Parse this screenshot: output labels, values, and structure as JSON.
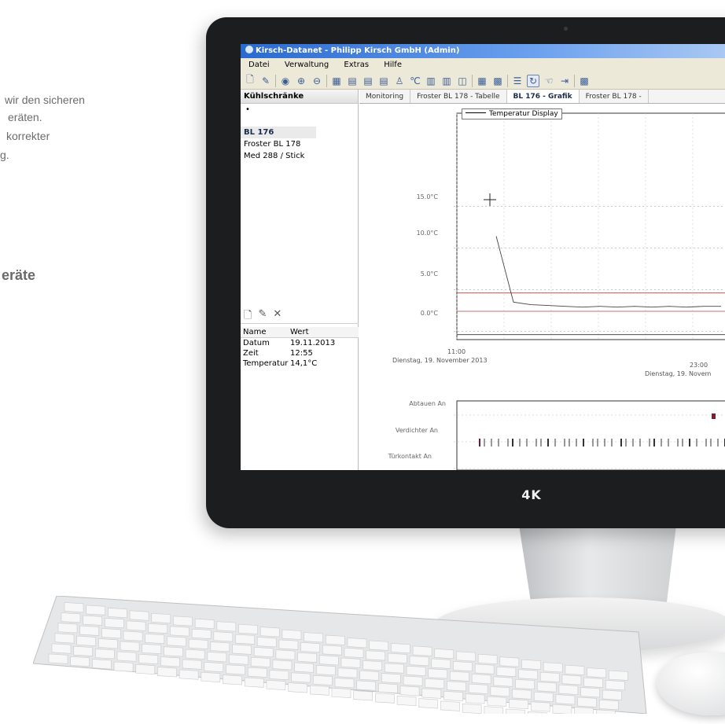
{
  "promo": {
    "line1": "wir den sicheren",
    "line2": "eräten.",
    "line3": "korrekter",
    "line4": "g.",
    "heading": "eräte"
  },
  "monitor": {
    "logo": "4K"
  },
  "app": {
    "title": "Kirsch-Datanet - Philipp Kirsch GmbH (Admin)",
    "menu": [
      "Datei",
      "Verwaltung",
      "Extras",
      "Hilfe"
    ],
    "left_pane": {
      "title": "Kühlschränke",
      "dot": "•",
      "items": [
        "BL 176",
        "Froster BL 178",
        "Med 288 / Stick"
      ]
    },
    "properties": {
      "col_name": "Name",
      "col_value": "Wert",
      "rows": [
        {
          "name": "Datum",
          "value": "19.11.2013"
        },
        {
          "name": "Zeit",
          "value": "12:55"
        },
        {
          "name": "Temperatur",
          "value": "14,1°C"
        }
      ]
    },
    "tabs": [
      "Monitoring",
      "Froster BL 178 - Tabelle",
      "BL 176 - Grafik",
      "Froster BL 178 -"
    ],
    "active_tab_index": 2
  },
  "chart_data": {
    "type": "line",
    "legend": "Temperatur Display",
    "y_ticks": [
      "15.0°C",
      "10.0°C",
      "5.0°C",
      "0.0°C"
    ],
    "x_ticks": [
      {
        "time": "11:00",
        "date": "Dienstag, 19. November 2013"
      },
      {
        "time": "23:00",
        "date": "Dienstag, 19. Novem"
      }
    ],
    "series": [
      {
        "values": [
          11.4,
          11.4,
          3.5,
          3.2,
          3.1,
          3.0,
          2.9,
          3.0,
          2.9,
          3.0,
          2.9,
          3.0,
          2.9,
          3.0,
          3.0
        ]
      }
    ],
    "limit_lines": [
      4.6,
      2.4
    ],
    "signals": [
      "Abtauen An",
      "Verdichter An",
      "Türkontakt An"
    ]
  }
}
